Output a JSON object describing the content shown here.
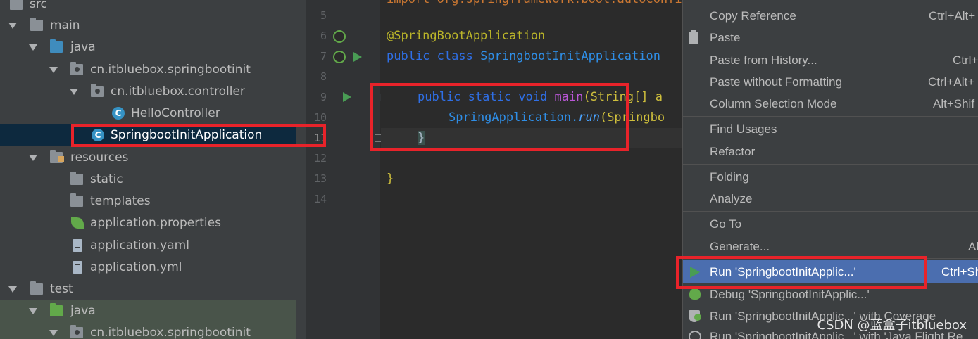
{
  "tree": {
    "items": [
      {
        "label": "src",
        "icon": "folder-icon"
      },
      {
        "label": "main",
        "icon": "folder-icon"
      },
      {
        "label": "java",
        "icon": "source-folder-icon"
      },
      {
        "label": "cn.itbluebox.springbootinit",
        "icon": "package-icon"
      },
      {
        "label": "cn.itbluebox.controller",
        "icon": "package-icon"
      },
      {
        "label": "HelloController",
        "icon": "class-icon"
      },
      {
        "label": "SpringbootInitApplication",
        "icon": "spring-boot-class-icon"
      },
      {
        "label": "resources",
        "icon": "resources-folder-icon"
      },
      {
        "label": "static",
        "icon": "folder-icon"
      },
      {
        "label": "templates",
        "icon": "folder-icon"
      },
      {
        "label": "application.properties",
        "icon": "spring-properties-icon"
      },
      {
        "label": "application.yaml",
        "icon": "file-icon"
      },
      {
        "label": "application.yml",
        "icon": "file-icon"
      },
      {
        "label": "test",
        "icon": "folder-icon"
      },
      {
        "label": "java",
        "icon": "test-source-folder-icon"
      },
      {
        "label": "cn.itbluebox.springbootinit",
        "icon": "package-icon"
      }
    ],
    "class_icon_letter": "C"
  },
  "editor": {
    "line_numbers": [
      "5",
      "6",
      "7",
      "8",
      "9",
      "10",
      "11",
      "12",
      "13",
      "14"
    ],
    "current_line": "11",
    "lines": {
      "l4_text": "import org.springframework.boot.autoconfigure",
      "l6_ann": "@SpringBootApplication",
      "l7_kw": "public class ",
      "l7_cls": "SpringbootInitApplication",
      "l9_kw": "public static void ",
      "l9_m": "main",
      "l9_p": "(String[] a",
      "l10_cls": "SpringApplication.",
      "l10_run": "run",
      "l10_rest": "(Springbo",
      "l11_brace": "}",
      "l13_brace": "}"
    }
  },
  "menu": {
    "copy_reference": {
      "label": "Copy Reference",
      "shortcut": "Ctrl+Alt+"
    },
    "paste": {
      "label": "Paste",
      "shortcut": ""
    },
    "paste_history": {
      "label": "Paste from History...",
      "shortcut": "Ctrl+"
    },
    "paste_no_format": {
      "label": "Paste without Formatting",
      "shortcut": "Ctrl+Alt+"
    },
    "column_mode": {
      "label": "Column Selection Mode",
      "shortcut": "Alt+Shif"
    },
    "find_usages": {
      "label": "Find Usages",
      "shortcut": ""
    },
    "refactor": {
      "label": "Refactor",
      "shortcut": ""
    },
    "folding": {
      "label": "Folding",
      "shortcut": ""
    },
    "analyze": {
      "label": "Analyze",
      "shortcut": ""
    },
    "go_to": {
      "label": "Go To",
      "shortcut": ""
    },
    "generate": {
      "label": "Generate...",
      "shortcut": "Al"
    },
    "run": {
      "label": "Run 'SpringbootInitApplic...'",
      "shortcut": "Ctrl+Sh"
    },
    "debug": {
      "label": "Debug 'SpringbootInitApplic...'",
      "shortcut": ""
    },
    "run_coverage": {
      "label": "Run 'SpringbootInitApplic...' with Coverage",
      "shortcut": ""
    },
    "run_jfr": {
      "label": "Run 'SpringbootInitApplic...' with 'Java Flight Re",
      "shortcut": ""
    }
  },
  "watermark": "CSDN @蓝盒子itbluebox",
  "colors": {
    "highlight_box": "#e8232a",
    "menu_selection": "#4b6eaf",
    "tree_selection": "#0d293e"
  }
}
